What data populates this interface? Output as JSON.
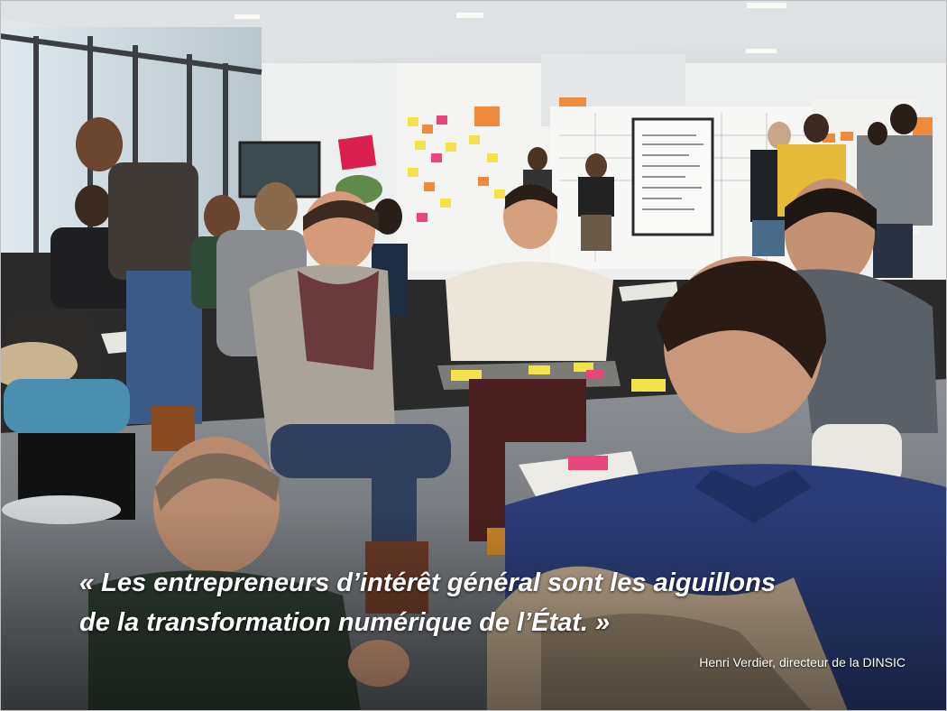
{
  "photo": {
    "description_icon": "workshop-photo",
    "colors": {
      "quote_text": "#ffffff",
      "sticky_yellow": "#f3e24a",
      "sticky_pink": "#e8467c",
      "sticky_orange": "#f08a3c"
    }
  },
  "quote": {
    "line1": "« Les entrepreneurs d’intérêt général sont les aiguillons",
    "line2": "de la transformation numérique de l’État. »"
  },
  "attribution": "Henri Verdier, directeur de la DINSIC",
  "sign_text": ""
}
